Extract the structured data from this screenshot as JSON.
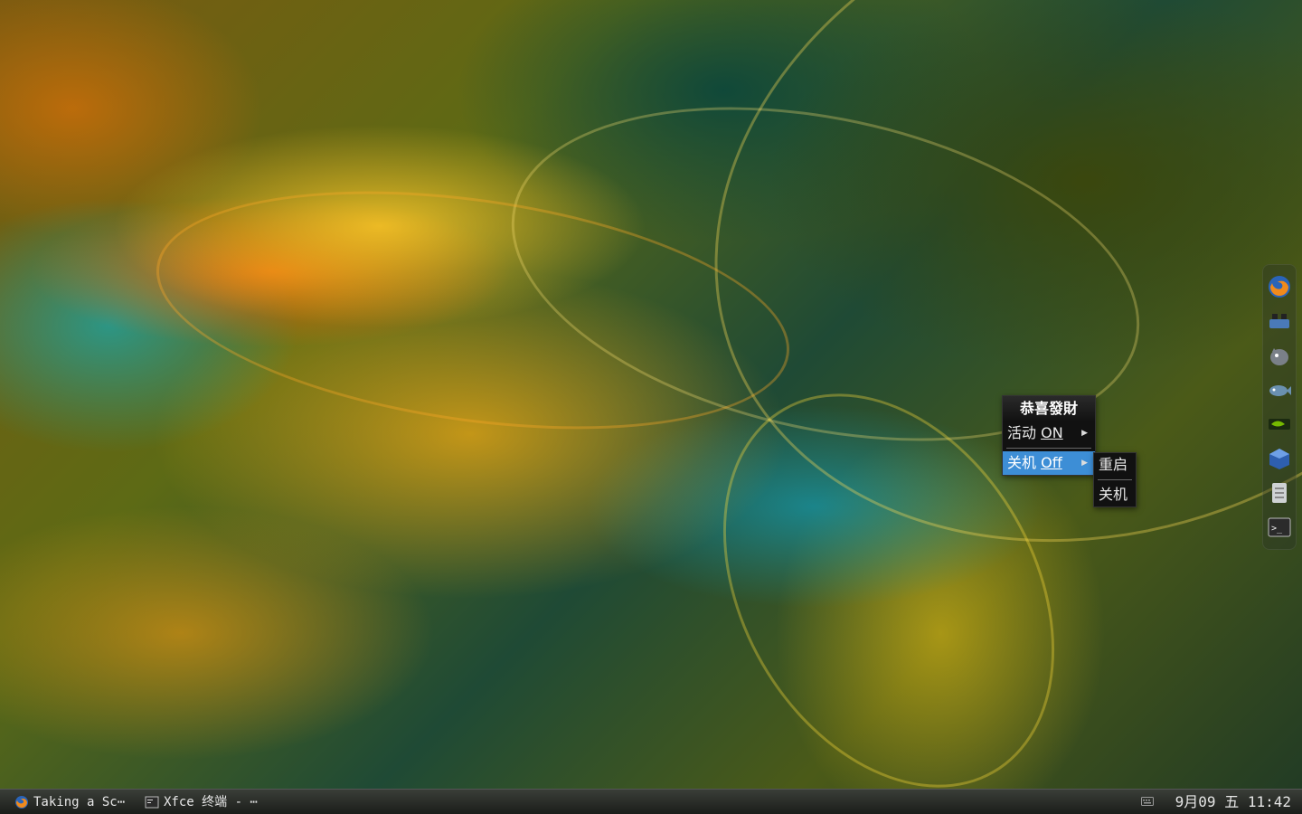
{
  "desktop": {
    "wallpaper_name": "abstract-swirl-wallpaper"
  },
  "dock": {
    "items": [
      {
        "name": "firefox-icon"
      },
      {
        "name": "network-icon"
      },
      {
        "name": "pidgin-icon"
      },
      {
        "name": "fish-icon"
      },
      {
        "name": "nvidia-icon"
      },
      {
        "name": "virtualbox-icon"
      },
      {
        "name": "file-manager-icon"
      },
      {
        "name": "terminal-icon"
      }
    ]
  },
  "menu": {
    "header": "恭喜發財",
    "items": [
      {
        "prefix": "活动 ",
        "mnemonic": "ON",
        "has_submenu": true
      },
      {
        "prefix": "关机 ",
        "mnemonic": "Off",
        "has_submenu": true,
        "active": true
      }
    ],
    "submenu": {
      "items": [
        {
          "label": "重启"
        },
        {
          "label": "关机"
        }
      ]
    }
  },
  "taskbar": {
    "tasks": [
      {
        "label": "Taking a Sc⋯",
        "icon": "firefox-icon"
      },
      {
        "label": "Xfce 终端 - ⋯",
        "icon": "terminal-icon"
      }
    ],
    "clock": "9月09 五 11:42",
    "tray_icon": "keyboard-icon"
  },
  "colors": {
    "menu_highlight": "#3d8ed6",
    "menu_bg": "#111111",
    "taskbar_bg": "#2a2d28"
  }
}
